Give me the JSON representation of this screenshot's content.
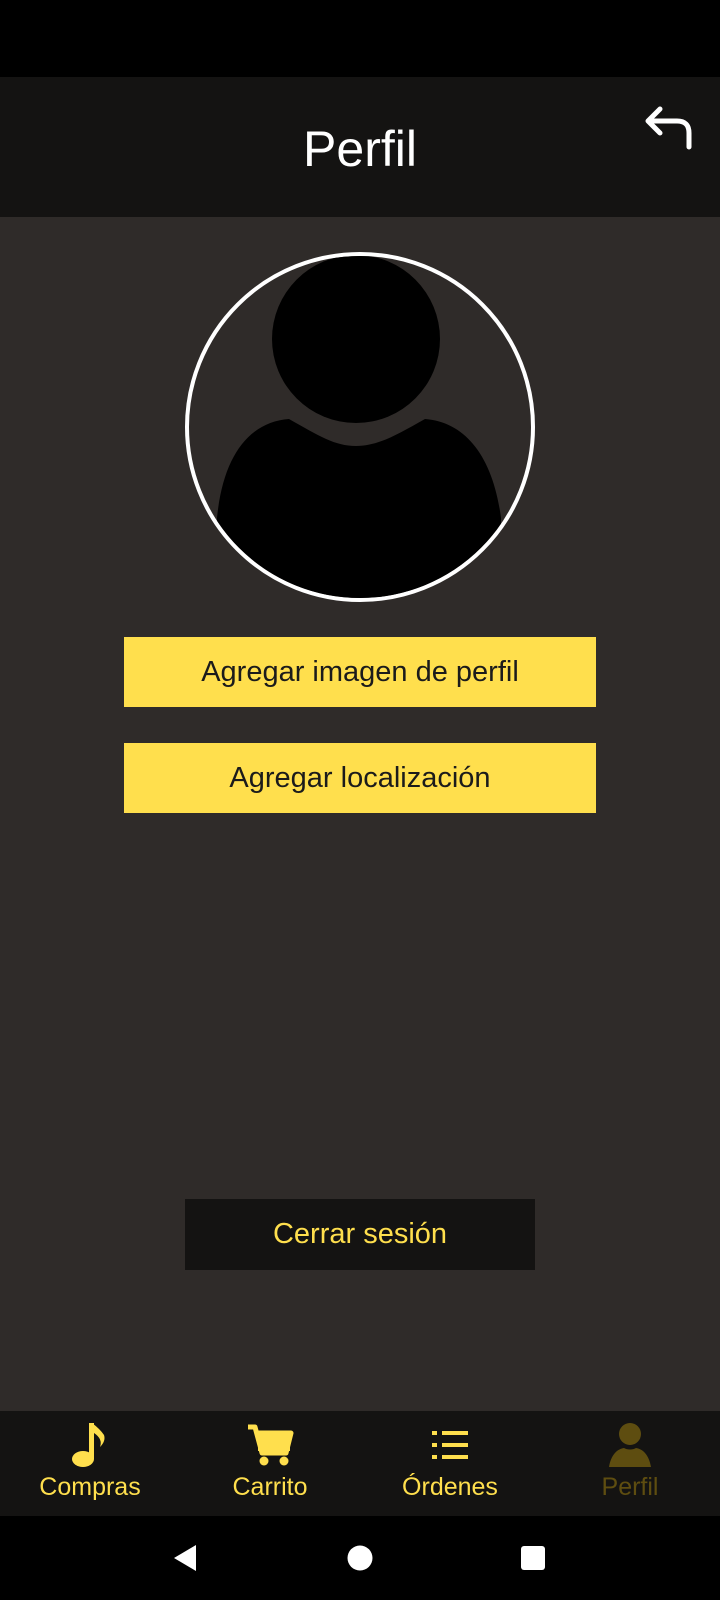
{
  "app_bar": {
    "title": "Perfil",
    "back_icon": "undo-arrow-icon"
  },
  "profile": {
    "avatar_icon": "person-silhouette-icon",
    "add_image_label": "Agregar imagen de perfil",
    "add_location_label": "Agregar localización",
    "logout_label": "Cerrar sesión"
  },
  "bottom_nav": {
    "items": [
      {
        "label": "Compras",
        "icon": "music-note-icon"
      },
      {
        "label": "Carrito",
        "icon": "shopping-cart-icon"
      },
      {
        "label": "Órdenes",
        "icon": "list-icon"
      },
      {
        "label": "Perfil",
        "icon": "person-icon"
      }
    ],
    "selected": "Perfil"
  },
  "colors": {
    "accent": "#ffdf4d",
    "app_bar_bg": "#141312",
    "content_bg": "#2f2b29",
    "nav_selected": "#5e4d10"
  }
}
